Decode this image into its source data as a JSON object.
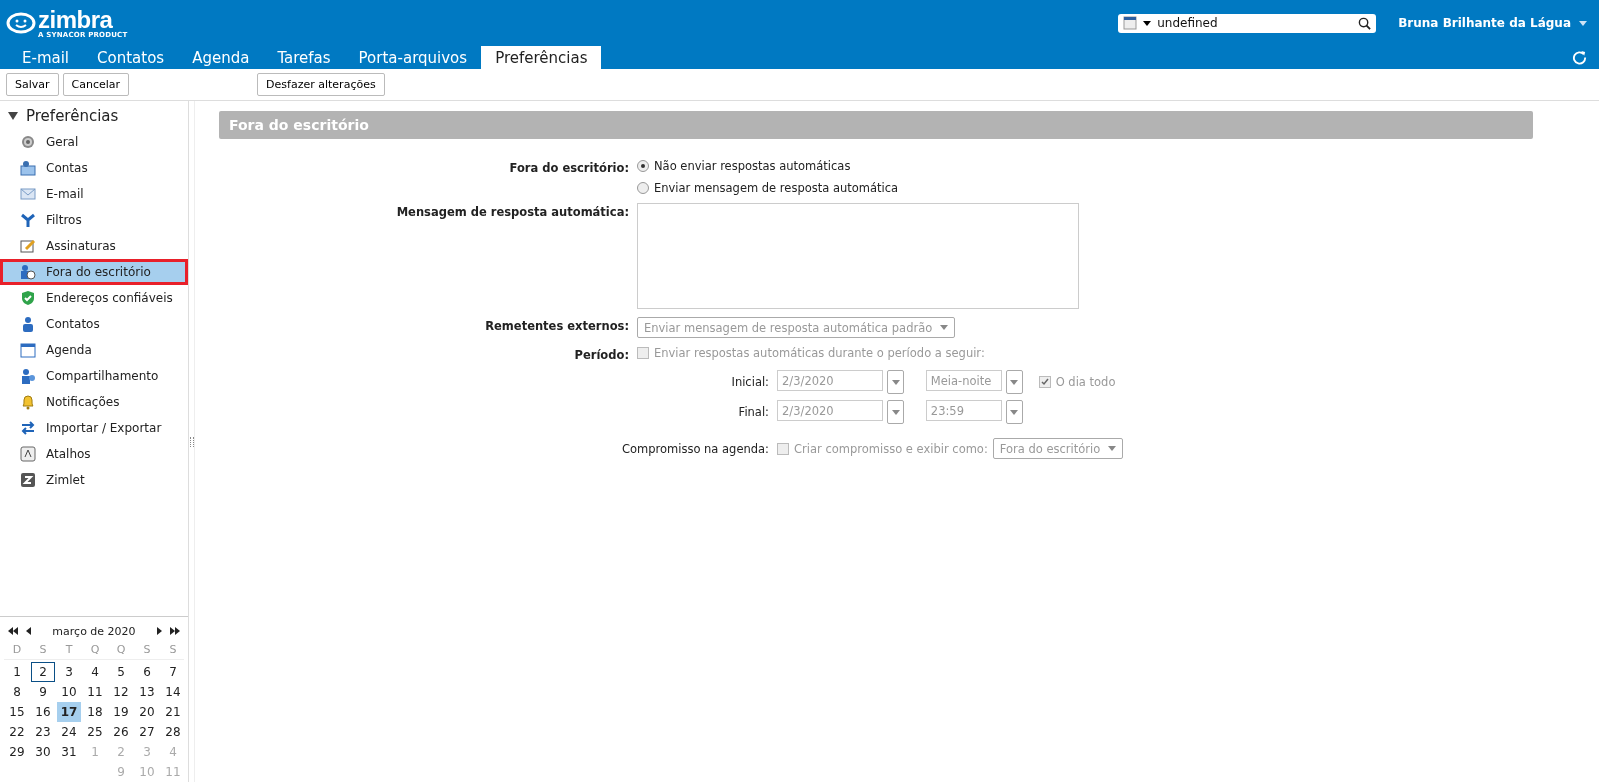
{
  "header": {
    "logo": {
      "name": "zimbra",
      "tagline": "A SYNACOR PRODUCT"
    },
    "search": {
      "value": "undefined"
    },
    "user": "Bruna Brilhante da Lágua"
  },
  "tabs": [
    {
      "label": "E-mail",
      "selected": false
    },
    {
      "label": "Contatos",
      "selected": false
    },
    {
      "label": "Agenda",
      "selected": false
    },
    {
      "label": "Tarefas",
      "selected": false
    },
    {
      "label": "Porta-arquivos",
      "selected": false
    },
    {
      "label": "Preferências",
      "selected": true
    }
  ],
  "toolbar": {
    "buttons": [
      "Salvar",
      "Cancelar"
    ],
    "undo": "Desfazer alterações"
  },
  "sidebar": {
    "title": "Preferências",
    "expanded": true,
    "items": [
      {
        "label": "Geral",
        "selected": false
      },
      {
        "label": "Contas",
        "selected": false
      },
      {
        "label": "E-mail",
        "selected": false
      },
      {
        "label": "Filtros",
        "selected": false
      },
      {
        "label": "Assinaturas",
        "selected": false
      },
      {
        "label": "Fora do escritório",
        "selected": true
      },
      {
        "label": "Endereços confiáveis",
        "selected": false
      },
      {
        "label": "Contatos",
        "selected": false
      },
      {
        "label": "Agenda",
        "selected": false
      },
      {
        "label": "Compartilhamento",
        "selected": false
      },
      {
        "label": "Notificações",
        "selected": false
      },
      {
        "label": "Importar / Exportar",
        "selected": false
      },
      {
        "label": "Atalhos",
        "selected": false
      },
      {
        "label": "Zimlet",
        "selected": false
      }
    ]
  },
  "mini_calendar": {
    "month": "março de 2020",
    "weekdays": [
      "D",
      "S",
      "T",
      "Q",
      "Q",
      "S",
      "S"
    ],
    "weeks": [
      [
        {
          "day": "1",
          "muted": false,
          "selected": false,
          "today": false
        },
        {
          "day": "2",
          "muted": false,
          "selected": true,
          "today": false
        },
        {
          "day": "3",
          "muted": false,
          "selected": false,
          "today": false
        },
        {
          "day": "4",
          "muted": false,
          "selected": false,
          "today": false
        },
        {
          "day": "5",
          "muted": false,
          "selected": false,
          "today": false
        },
        {
          "day": "6",
          "muted": false,
          "selected": false,
          "today": false
        },
        {
          "day": "7",
          "muted": false,
          "selected": false,
          "today": false
        }
      ],
      [
        {
          "day": "8",
          "muted": false,
          "selected": false,
          "today": false
        },
        {
          "day": "9",
          "muted": false,
          "selected": false,
          "today": false
        },
        {
          "day": "10",
          "muted": false,
          "selected": false,
          "today": false
        },
        {
          "day": "11",
          "muted": false,
          "selected": false,
          "today": false
        },
        {
          "day": "12",
          "muted": false,
          "selected": false,
          "today": false
        },
        {
          "day": "13",
          "muted": false,
          "selected": false,
          "today": false
        },
        {
          "day": "14",
          "muted": false,
          "selected": false,
          "today": false
        }
      ],
      [
        {
          "day": "15",
          "muted": false,
          "selected": false,
          "today": false
        },
        {
          "day": "16",
          "muted": false,
          "selected": false,
          "today": false
        },
        {
          "day": "17",
          "muted": false,
          "selected": false,
          "today": true
        },
        {
          "day": "18",
          "muted": false,
          "selected": false,
          "today": false
        },
        {
          "day": "19",
          "muted": false,
          "selected": false,
          "today": false
        },
        {
          "day": "20",
          "muted": false,
          "selected": false,
          "today": false
        },
        {
          "day": "21",
          "muted": false,
          "selected": false,
          "today": false
        }
      ],
      [
        {
          "day": "22",
          "muted": false,
          "selected": false,
          "today": false
        },
        {
          "day": "23",
          "muted": false,
          "selected": false,
          "today": false
        },
        {
          "day": "24",
          "muted": false,
          "selected": false,
          "today": false
        },
        {
          "day": "25",
          "muted": false,
          "selected": false,
          "today": false
        },
        {
          "day": "26",
          "muted": false,
          "selected": false,
          "today": false
        },
        {
          "day": "27",
          "muted": false,
          "selected": false,
          "today": false
        },
        {
          "day": "28",
          "muted": false,
          "selected": false,
          "today": false
        }
      ],
      [
        {
          "day": "29",
          "muted": false,
          "selected": false,
          "today": false
        },
        {
          "day": "30",
          "muted": false,
          "selected": false,
          "today": false
        },
        {
          "day": "31",
          "muted": false,
          "selected": false,
          "today": false
        },
        {
          "day": "1",
          "muted": true,
          "selected": false,
          "today": false
        },
        {
          "day": "2",
          "muted": true,
          "selected": false,
          "today": false
        },
        {
          "day": "3",
          "muted": true,
          "selected": false,
          "today": false
        },
        {
          "day": "4",
          "muted": true,
          "selected": false,
          "today": false
        }
      ],
      [
        {
          "day": "9",
          "muted": true,
          "selected": false,
          "today": false
        },
        {
          "day": "10",
          "muted": true,
          "selected": false,
          "today": false
        },
        {
          "day": "11",
          "muted": true,
          "selected": false,
          "today": false
        }
      ]
    ]
  },
  "section": {
    "title": "Fora do escritório",
    "out_of_office": {
      "label": "Fora do escritório:",
      "options": [
        {
          "label": "Não enviar respostas automáticas",
          "selected": true
        },
        {
          "label": "Enviar mensagem de resposta automática",
          "selected": false
        }
      ]
    },
    "message": {
      "label": "Mensagem de resposta automática:"
    },
    "external_senders": {
      "label": "Remetentes externos:",
      "value": "Enviar mensagem de resposta automática padrão",
      "disabled": true
    },
    "period": {
      "label": "Período:",
      "disabled": true,
      "checkbox": {
        "label": "Enviar respostas automáticas durante o período a seguir:",
        "checked": false
      },
      "start": {
        "label": "Inicial:",
        "date": "2/3/2020",
        "time": "Meia-noite",
        "all_day": {
          "label": "O dia todo",
          "checked": true
        }
      },
      "end": {
        "label": "Final:",
        "date": "2/3/2020",
        "time": "23:59"
      }
    },
    "appointment": {
      "label": "Compromisso na agenda:",
      "disabled": true,
      "checkbox": {
        "label": "Criar compromisso e exibir como:",
        "checked": false
      },
      "value": "Fora do escritório"
    }
  }
}
